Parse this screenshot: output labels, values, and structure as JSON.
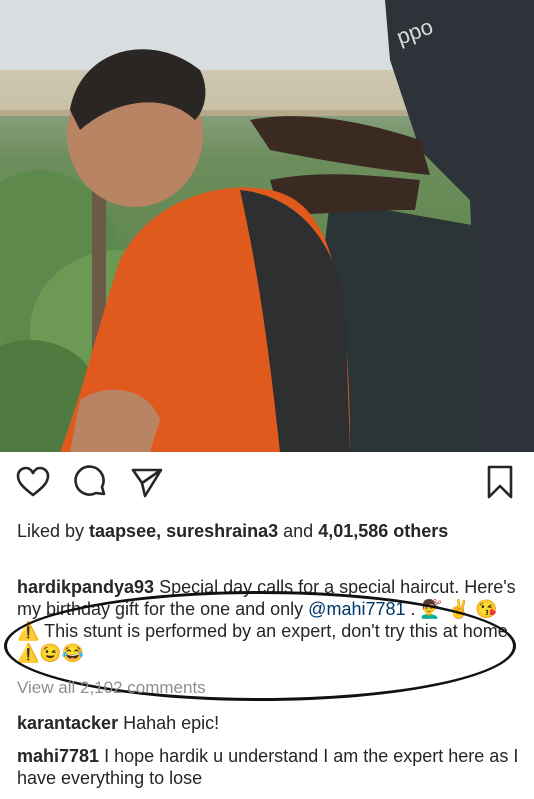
{
  "post": {
    "image_icons": {
      "brand_text": "ppo"
    },
    "actions": {
      "like_icon": "heart-icon",
      "comment_icon": "comment-icon",
      "share_icon": "send-icon",
      "save_icon": "bookmark-icon"
    },
    "likes": {
      "prefix": "Liked by ",
      "users": "taapsee, sureshraina3",
      "middle": " and ",
      "count": "4,01,586",
      "suffix": " others"
    },
    "caption": {
      "username": "hardikpandya93",
      "text1": " Special day calls for a special haircut. Here's my birthday gift for the one and only ",
      "mention": "@mahi7781",
      "text2": " . 💇‍♂️ ✌️ 😘 ⚠️ This stunt is performed by an expert, don't try this at home ⚠️😉😂"
    },
    "view_all": "View all 2,102 comments",
    "comments": [
      {
        "username": "karantacker",
        "text": " Hahah epic!"
      },
      {
        "username": "mahi7781",
        "text": " I hope hardik u understand I am the expert here as I have everything to lose"
      }
    ]
  }
}
